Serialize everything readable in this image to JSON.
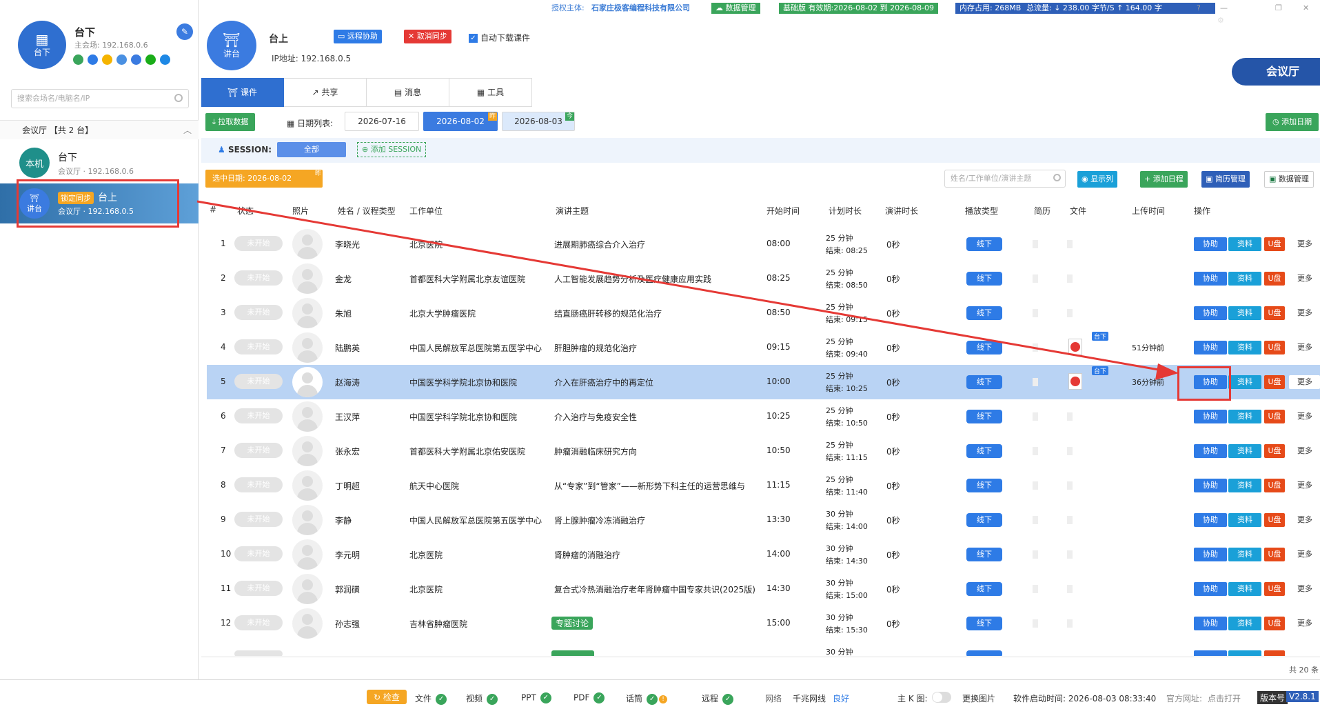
{
  "topbar": {
    "auth": "授权主体:",
    "company": "石家庄极客编程科技有限公司",
    "data_mgmt": "数据管理",
    "version": "基础版 有效期:2026-08-02 到 2026-08-09",
    "memory": "内存占用: 268MB",
    "total": "总流量: ↓ 238.00 字节/S ↑ 164.00 字"
  },
  "sidebar": {
    "device": {
      "avatar": "台下",
      "name": "台下",
      "ip": "主会场: 192.168.0.6"
    },
    "search_placeholder": "搜索会场名/电脑名/IP",
    "group": "会议厅 【共 2 台】",
    "rows": [
      {
        "avatar": "本机",
        "name": "台下",
        "sub": "会议厅 · 192.168.0.6"
      },
      {
        "avatar": "讲台",
        "tag": "锁定同步",
        "name": "台上",
        "sub": "会议厅 · 192.168.0.5"
      }
    ]
  },
  "main": {
    "avatar": "讲台",
    "name": "台上",
    "ip": "IP地址: 192.168.0.5",
    "remote": "远程协助",
    "cancel_sync": "取消同步",
    "auto_dl": "自动下载课件",
    "hall": "会议厅"
  },
  "tabs": [
    "课件",
    "共享",
    "消息",
    "工具"
  ],
  "dates": {
    "pull": "拉取数据",
    "label": "日期列表:",
    "d1": "2026-07-16",
    "d2": "2026-08-02",
    "d3": "2026-08-03",
    "add": "添加日期",
    "yesterday": "昨",
    "today": "今"
  },
  "session": {
    "label": "SESSION:",
    "all": "全部",
    "add": "添加 SESSION"
  },
  "filter": {
    "selected": "选中日期: 2026-08-02",
    "search_placeholder": "姓名/工作单位/演讲主题",
    "show_cols": "显示列",
    "add_schedule": "添加日程",
    "cv": "简历管理",
    "data": "数据管理"
  },
  "headers": [
    "#",
    "状态",
    "照片",
    "姓名 / 议程类型",
    "工作单位",
    "演讲主题",
    "开始时间",
    "计划时长",
    "演讲时长",
    "播放类型",
    "简历",
    "文件",
    "上传时间",
    "操作"
  ],
  "rows": [
    {
      "n": "1",
      "status": "未开始",
      "name": "李晓光",
      "org": "北京医院",
      "topic": "进展期肺癌综合介入治疗",
      "start": "08:00",
      "dur": "25 分钟",
      "end": "结束: 08:25",
      "spk": "0秒",
      "play": "线下",
      "up": ""
    },
    {
      "n": "2",
      "status": "未开始",
      "name": "金龙",
      "org": "首都医科大学附属北京友谊医院",
      "topic": "人工智能发展趋势分析及医疗健康应用实践",
      "start": "08:25",
      "dur": "25 分钟",
      "end": "结束: 08:50",
      "spk": "0秒",
      "play": "线下",
      "up": ""
    },
    {
      "n": "3",
      "status": "未开始",
      "name": "朱旭",
      "org": "北京大学肿瘤医院",
      "topic": "结直肠癌肝转移的规范化治疗",
      "start": "08:50",
      "dur": "25 分钟",
      "end": "结束: 09:15",
      "spk": "0秒",
      "play": "线下",
      "up": ""
    },
    {
      "n": "4",
      "status": "未开始",
      "name": "陆鹏英",
      "org": "中国人民解放军总医院第五医学中心",
      "topic": "肝胆肿瘤的规范化治疗",
      "start": "09:15",
      "dur": "25 分钟",
      "end": "结束: 09:40",
      "spk": "0秒",
      "play": "线下",
      "up": "51分钟前",
      "file": true
    },
    {
      "n": "5",
      "status": "未开始",
      "name": "赵海涛",
      "org": "中国医学科学院北京协和医院",
      "topic": "介入在肝癌治疗中的再定位",
      "start": "10:00",
      "dur": "25 分钟",
      "end": "结束: 10:25",
      "spk": "0秒",
      "play": "线下",
      "up": "36分钟前",
      "file": true,
      "sel": true
    },
    {
      "n": "6",
      "status": "未开始",
      "name": "王汉萍",
      "org": "中国医学科学院北京协和医院",
      "topic": "介入治疗与免疫安全性",
      "start": "10:25",
      "dur": "25 分钟",
      "end": "结束: 10:50",
      "spk": "0秒",
      "play": "线下",
      "up": ""
    },
    {
      "n": "7",
      "status": "未开始",
      "name": "张永宏",
      "org": "首都医科大学附属北京佑安医院",
      "topic": "肿瘤消融临床研究方向",
      "start": "10:50",
      "dur": "25 分钟",
      "end": "结束: 11:15",
      "spk": "0秒",
      "play": "线下",
      "up": ""
    },
    {
      "n": "8",
      "status": "未开始",
      "name": "丁明超",
      "org": "航天中心医院",
      "topic": "从“专家”到“管家”——新形势下科主任的运营思维与",
      "start": "11:15",
      "dur": "25 分钟",
      "end": "结束: 11:40",
      "spk": "0秒",
      "play": "线下",
      "up": ""
    },
    {
      "n": "9",
      "status": "未开始",
      "name": "李静",
      "org": "中国人民解放军总医院第五医学中心",
      "topic": "肾上腺肿瘤冷冻消融治疗",
      "start": "13:30",
      "dur": "30 分钟",
      "end": "结束: 14:00",
      "spk": "0秒",
      "play": "线下",
      "up": ""
    },
    {
      "n": "10",
      "status": "未开始",
      "name": "李元明",
      "org": "北京医院",
      "topic": "肾肿瘤的消融治疗",
      "start": "14:00",
      "dur": "30 分钟",
      "end": "结束: 14:30",
      "spk": "0秒",
      "play": "线下",
      "up": ""
    },
    {
      "n": "11",
      "status": "未开始",
      "name": "郭润磺",
      "org": "北京医院",
      "topic": "复合式冷热消融治疗老年肾肿瘤中国专家共识(2025版)",
      "start": "14:30",
      "dur": "30 分钟",
      "end": "结束: 15:00",
      "spk": "0秒",
      "play": "线下",
      "up": ""
    },
    {
      "n": "12",
      "status": "未开始",
      "name": "孙志强",
      "org": "吉林省肿瘤医院",
      "topic": "专题讨论",
      "start": "15:00",
      "dur": "30 分钟",
      "end": "结束: 15:30",
      "spk": "0秒",
      "play": "线下",
      "up": "",
      "topic_tag": true
    }
  ],
  "actions": {
    "assist": "协助",
    "material": "资料",
    "usb": "U盘",
    "more": "更多"
  },
  "file_tag": "台下",
  "partial_dur": "30 分钟",
  "total": "共 20 条",
  "status": {
    "check": "检查",
    "file": "文件",
    "video": "视频",
    "ppt": "PPT",
    "pdf": "PDF",
    "words": "话筒",
    "remote": "远程",
    "net": "网络",
    "net_val": "千兆网线",
    "net_good": "良好",
    "k": "主 K 图:",
    "change_pic": "更换图片",
    "start_time": "软件启动时间: 2026-08-03 08:33:40",
    "site": "官方网址:",
    "open": "点击打开",
    "ver_label": "版本号",
    "ver": "V2.8.1"
  }
}
